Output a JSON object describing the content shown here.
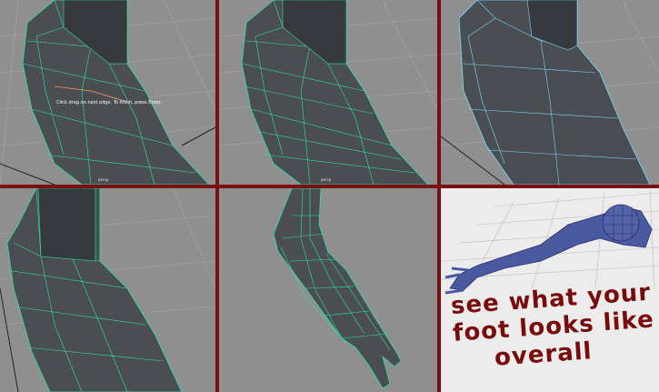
{
  "panels": [
    {
      "name": "step-1",
      "hint": "Click drag on next edge. To finish, press Enter.",
      "camera_label": "persp"
    },
    {
      "name": "step-2",
      "camera_label": "persp"
    },
    {
      "name": "step-3"
    },
    {
      "name": "step-4"
    },
    {
      "name": "step-5"
    },
    {
      "name": "step-6"
    }
  ],
  "note": {
    "line1": "see what your",
    "line2": "foot looks like",
    "line3": "overall"
  },
  "colors": {
    "frame": "#7a0f0f",
    "viewport": "#8f8f8f",
    "mesh": "#4a4d52",
    "wire": "#2fe3a6",
    "note": "#7a0b0b"
  }
}
